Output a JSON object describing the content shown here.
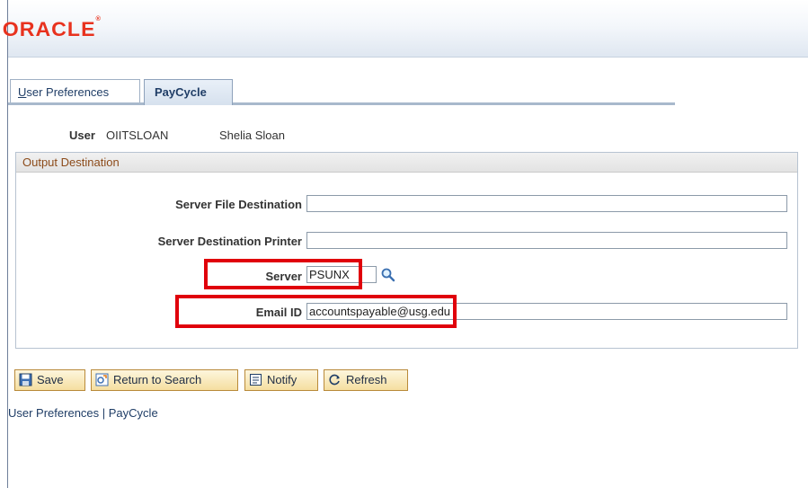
{
  "header": {
    "logo_text": "ORACLE",
    "logo_mark": "®",
    "brand_color": "#e8321e"
  },
  "tabs": [
    {
      "label_underlined": "U",
      "label_rest": "ser Preferences",
      "active": false
    },
    {
      "label": "PayCycle",
      "active": true
    }
  ],
  "user": {
    "label": "User",
    "id": "OIITSLOAN",
    "name": "Shelia Sloan"
  },
  "output_destination": {
    "title": "Output Destination",
    "server_file_destination": {
      "label": "Server File Destination",
      "value": ""
    },
    "server_destination_printer": {
      "label": "Server Destination Printer",
      "value": ""
    },
    "server": {
      "label": "Server",
      "value": "PSUNX",
      "icon": "lookup-magnifier-icon"
    },
    "email_id": {
      "label": "Email ID",
      "value": "accountspayable@usg.edu"
    }
  },
  "toolbar": {
    "save": "Save",
    "return_to_search": "Return to Search",
    "notify": "Notify",
    "refresh": "Refresh"
  },
  "footer_links": {
    "user_preferences": "User Preferences",
    "separator": " | ",
    "paycycle": "PayCycle"
  },
  "colors": {
    "highlight": "#e0000b",
    "group_title": "#8c4b1a",
    "button_border": "#b98a3a"
  }
}
